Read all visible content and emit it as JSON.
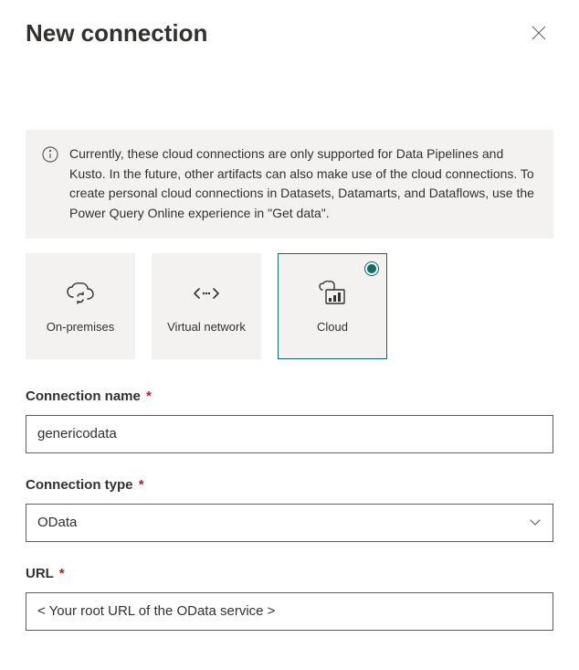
{
  "header": {
    "title": "New connection"
  },
  "info": {
    "text": "Currently, these cloud connections are only supported for Data Pipelines and Kusto. In the future, other artifacts can also make use of the cloud connections. To create personal cloud connections in Datasets, Datamarts, and Dataflows, use the Power Query Online experience in \"Get data\"."
  },
  "tiles": {
    "onprem": {
      "label": "On-premises",
      "selected": false
    },
    "vnet": {
      "label": "Virtual network",
      "selected": false
    },
    "cloud": {
      "label": "Cloud",
      "selected": true
    }
  },
  "form": {
    "connectionName": {
      "label": "Connection name",
      "value": "genericodata",
      "required": true
    },
    "connectionType": {
      "label": "Connection type",
      "value": "OData",
      "required": true
    },
    "url": {
      "label": "URL",
      "value": "< Your root URL of the OData service >",
      "required": true
    }
  }
}
